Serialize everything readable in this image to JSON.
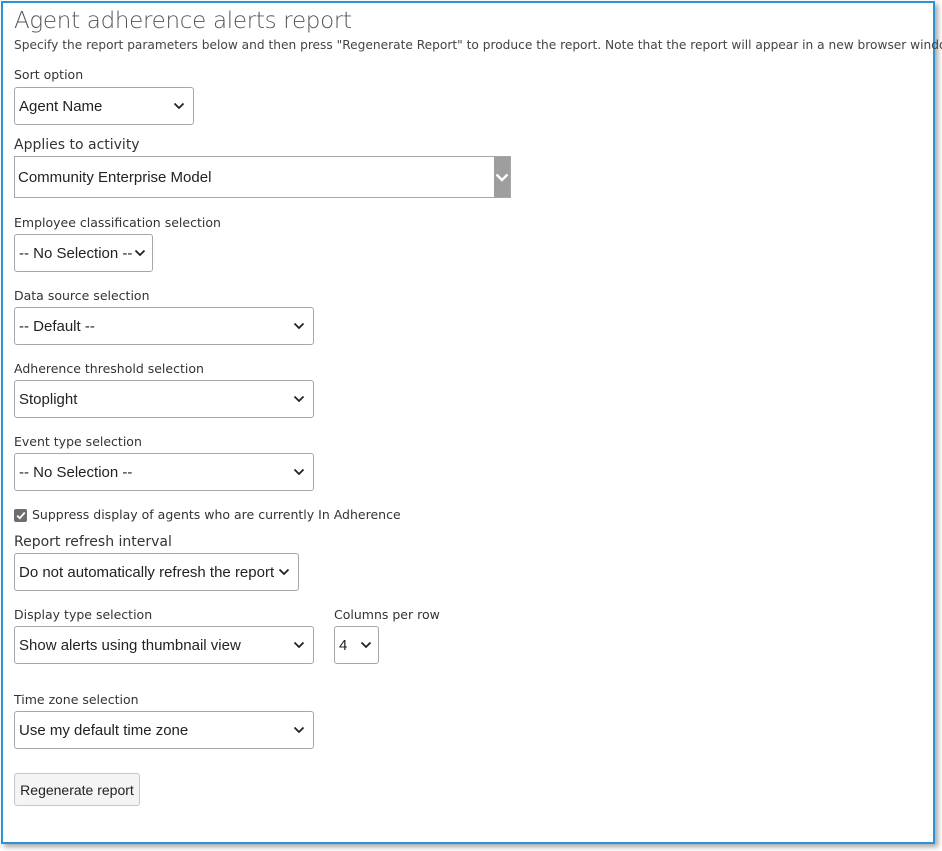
{
  "header": {
    "title": "Agent adherence alerts report",
    "description": "Specify the report parameters below and then press \"Regenerate Report\" to produce the report. Note that the report will appear in a new browser window."
  },
  "form": {
    "sort": {
      "label": "Sort option",
      "value": "Agent Name"
    },
    "activity": {
      "label": "Applies to activity",
      "value": "Community Enterprise Model"
    },
    "employee_classification": {
      "label": "Employee classification selection",
      "value": "-- No Selection --"
    },
    "data_source": {
      "label": "Data source selection",
      "value": "-- Default --"
    },
    "adherence_threshold": {
      "label": "Adherence threshold selection",
      "value": "Stoplight"
    },
    "event_type": {
      "label": "Event type selection",
      "value": "-- No Selection --"
    },
    "suppress": {
      "label": "Suppress display of agents who are currently In Adherence",
      "checked": true
    },
    "refresh_interval": {
      "label": "Report refresh interval",
      "value": "Do not automatically refresh the report"
    },
    "display_type": {
      "label": "Display type selection",
      "value": "Show alerts using thumbnail view"
    },
    "columns_per_row": {
      "label": "Columns per row",
      "value": "4"
    },
    "time_zone": {
      "label": "Time zone selection",
      "value": "Use my default time zone"
    },
    "regenerate_label": "Regenerate report"
  },
  "colors": {
    "frame_border": "#2a93d5",
    "checkbox": "#6d6d6d"
  },
  "icons": {
    "dropdown": "chevron-down-icon",
    "check": "check-icon"
  }
}
